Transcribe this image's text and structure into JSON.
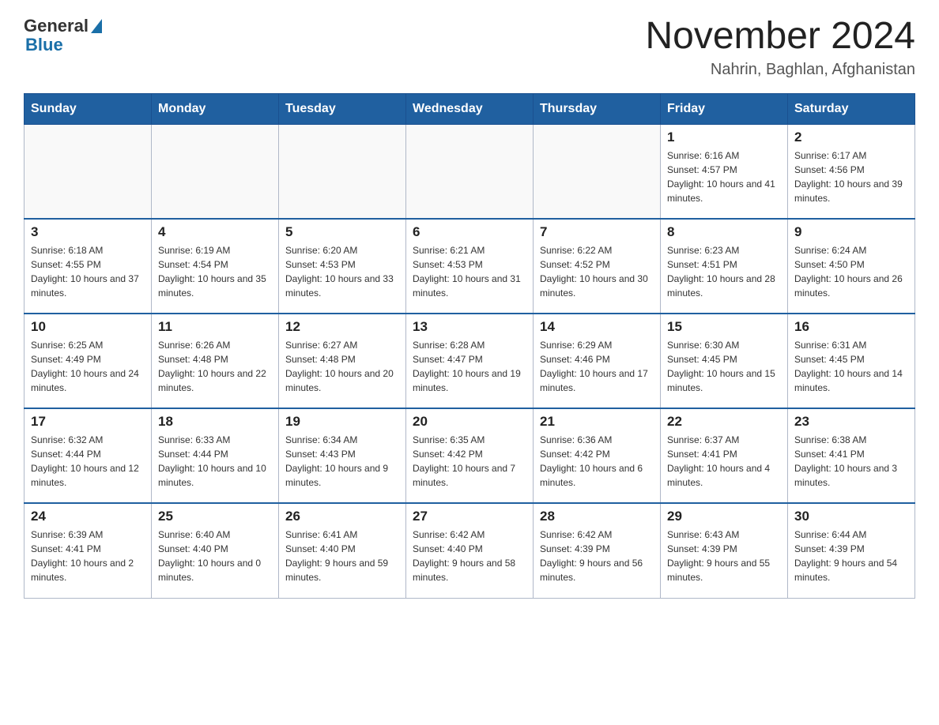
{
  "header": {
    "logo_general": "General",
    "logo_blue": "Blue",
    "month_title": "November 2024",
    "location": "Nahrin, Baghlan, Afghanistan"
  },
  "weekdays": [
    "Sunday",
    "Monday",
    "Tuesday",
    "Wednesday",
    "Thursday",
    "Friday",
    "Saturday"
  ],
  "weeks": [
    [
      {
        "day": "",
        "sunrise": "",
        "sunset": "",
        "daylight": "",
        "empty": true
      },
      {
        "day": "",
        "sunrise": "",
        "sunset": "",
        "daylight": "",
        "empty": true
      },
      {
        "day": "",
        "sunrise": "",
        "sunset": "",
        "daylight": "",
        "empty": true
      },
      {
        "day": "",
        "sunrise": "",
        "sunset": "",
        "daylight": "",
        "empty": true
      },
      {
        "day": "",
        "sunrise": "",
        "sunset": "",
        "daylight": "",
        "empty": true
      },
      {
        "day": "1",
        "sunrise": "Sunrise: 6:16 AM",
        "sunset": "Sunset: 4:57 PM",
        "daylight": "Daylight: 10 hours and 41 minutes.",
        "empty": false
      },
      {
        "day": "2",
        "sunrise": "Sunrise: 6:17 AM",
        "sunset": "Sunset: 4:56 PM",
        "daylight": "Daylight: 10 hours and 39 minutes.",
        "empty": false
      }
    ],
    [
      {
        "day": "3",
        "sunrise": "Sunrise: 6:18 AM",
        "sunset": "Sunset: 4:55 PM",
        "daylight": "Daylight: 10 hours and 37 minutes.",
        "empty": false
      },
      {
        "day": "4",
        "sunrise": "Sunrise: 6:19 AM",
        "sunset": "Sunset: 4:54 PM",
        "daylight": "Daylight: 10 hours and 35 minutes.",
        "empty": false
      },
      {
        "day": "5",
        "sunrise": "Sunrise: 6:20 AM",
        "sunset": "Sunset: 4:53 PM",
        "daylight": "Daylight: 10 hours and 33 minutes.",
        "empty": false
      },
      {
        "day": "6",
        "sunrise": "Sunrise: 6:21 AM",
        "sunset": "Sunset: 4:53 PM",
        "daylight": "Daylight: 10 hours and 31 minutes.",
        "empty": false
      },
      {
        "day": "7",
        "sunrise": "Sunrise: 6:22 AM",
        "sunset": "Sunset: 4:52 PM",
        "daylight": "Daylight: 10 hours and 30 minutes.",
        "empty": false
      },
      {
        "day": "8",
        "sunrise": "Sunrise: 6:23 AM",
        "sunset": "Sunset: 4:51 PM",
        "daylight": "Daylight: 10 hours and 28 minutes.",
        "empty": false
      },
      {
        "day": "9",
        "sunrise": "Sunrise: 6:24 AM",
        "sunset": "Sunset: 4:50 PM",
        "daylight": "Daylight: 10 hours and 26 minutes.",
        "empty": false
      }
    ],
    [
      {
        "day": "10",
        "sunrise": "Sunrise: 6:25 AM",
        "sunset": "Sunset: 4:49 PM",
        "daylight": "Daylight: 10 hours and 24 minutes.",
        "empty": false
      },
      {
        "day": "11",
        "sunrise": "Sunrise: 6:26 AM",
        "sunset": "Sunset: 4:48 PM",
        "daylight": "Daylight: 10 hours and 22 minutes.",
        "empty": false
      },
      {
        "day": "12",
        "sunrise": "Sunrise: 6:27 AM",
        "sunset": "Sunset: 4:48 PM",
        "daylight": "Daylight: 10 hours and 20 minutes.",
        "empty": false
      },
      {
        "day": "13",
        "sunrise": "Sunrise: 6:28 AM",
        "sunset": "Sunset: 4:47 PM",
        "daylight": "Daylight: 10 hours and 19 minutes.",
        "empty": false
      },
      {
        "day": "14",
        "sunrise": "Sunrise: 6:29 AM",
        "sunset": "Sunset: 4:46 PM",
        "daylight": "Daylight: 10 hours and 17 minutes.",
        "empty": false
      },
      {
        "day": "15",
        "sunrise": "Sunrise: 6:30 AM",
        "sunset": "Sunset: 4:45 PM",
        "daylight": "Daylight: 10 hours and 15 minutes.",
        "empty": false
      },
      {
        "day": "16",
        "sunrise": "Sunrise: 6:31 AM",
        "sunset": "Sunset: 4:45 PM",
        "daylight": "Daylight: 10 hours and 14 minutes.",
        "empty": false
      }
    ],
    [
      {
        "day": "17",
        "sunrise": "Sunrise: 6:32 AM",
        "sunset": "Sunset: 4:44 PM",
        "daylight": "Daylight: 10 hours and 12 minutes.",
        "empty": false
      },
      {
        "day": "18",
        "sunrise": "Sunrise: 6:33 AM",
        "sunset": "Sunset: 4:44 PM",
        "daylight": "Daylight: 10 hours and 10 minutes.",
        "empty": false
      },
      {
        "day": "19",
        "sunrise": "Sunrise: 6:34 AM",
        "sunset": "Sunset: 4:43 PM",
        "daylight": "Daylight: 10 hours and 9 minutes.",
        "empty": false
      },
      {
        "day": "20",
        "sunrise": "Sunrise: 6:35 AM",
        "sunset": "Sunset: 4:42 PM",
        "daylight": "Daylight: 10 hours and 7 minutes.",
        "empty": false
      },
      {
        "day": "21",
        "sunrise": "Sunrise: 6:36 AM",
        "sunset": "Sunset: 4:42 PM",
        "daylight": "Daylight: 10 hours and 6 minutes.",
        "empty": false
      },
      {
        "day": "22",
        "sunrise": "Sunrise: 6:37 AM",
        "sunset": "Sunset: 4:41 PM",
        "daylight": "Daylight: 10 hours and 4 minutes.",
        "empty": false
      },
      {
        "day": "23",
        "sunrise": "Sunrise: 6:38 AM",
        "sunset": "Sunset: 4:41 PM",
        "daylight": "Daylight: 10 hours and 3 minutes.",
        "empty": false
      }
    ],
    [
      {
        "day": "24",
        "sunrise": "Sunrise: 6:39 AM",
        "sunset": "Sunset: 4:41 PM",
        "daylight": "Daylight: 10 hours and 2 minutes.",
        "empty": false
      },
      {
        "day": "25",
        "sunrise": "Sunrise: 6:40 AM",
        "sunset": "Sunset: 4:40 PM",
        "daylight": "Daylight: 10 hours and 0 minutes.",
        "empty": false
      },
      {
        "day": "26",
        "sunrise": "Sunrise: 6:41 AM",
        "sunset": "Sunset: 4:40 PM",
        "daylight": "Daylight: 9 hours and 59 minutes.",
        "empty": false
      },
      {
        "day": "27",
        "sunrise": "Sunrise: 6:42 AM",
        "sunset": "Sunset: 4:40 PM",
        "daylight": "Daylight: 9 hours and 58 minutes.",
        "empty": false
      },
      {
        "day": "28",
        "sunrise": "Sunrise: 6:42 AM",
        "sunset": "Sunset: 4:39 PM",
        "daylight": "Daylight: 9 hours and 56 minutes.",
        "empty": false
      },
      {
        "day": "29",
        "sunrise": "Sunrise: 6:43 AM",
        "sunset": "Sunset: 4:39 PM",
        "daylight": "Daylight: 9 hours and 55 minutes.",
        "empty": false
      },
      {
        "day": "30",
        "sunrise": "Sunrise: 6:44 AM",
        "sunset": "Sunset: 4:39 PM",
        "daylight": "Daylight: 9 hours and 54 minutes.",
        "empty": false
      }
    ]
  ]
}
